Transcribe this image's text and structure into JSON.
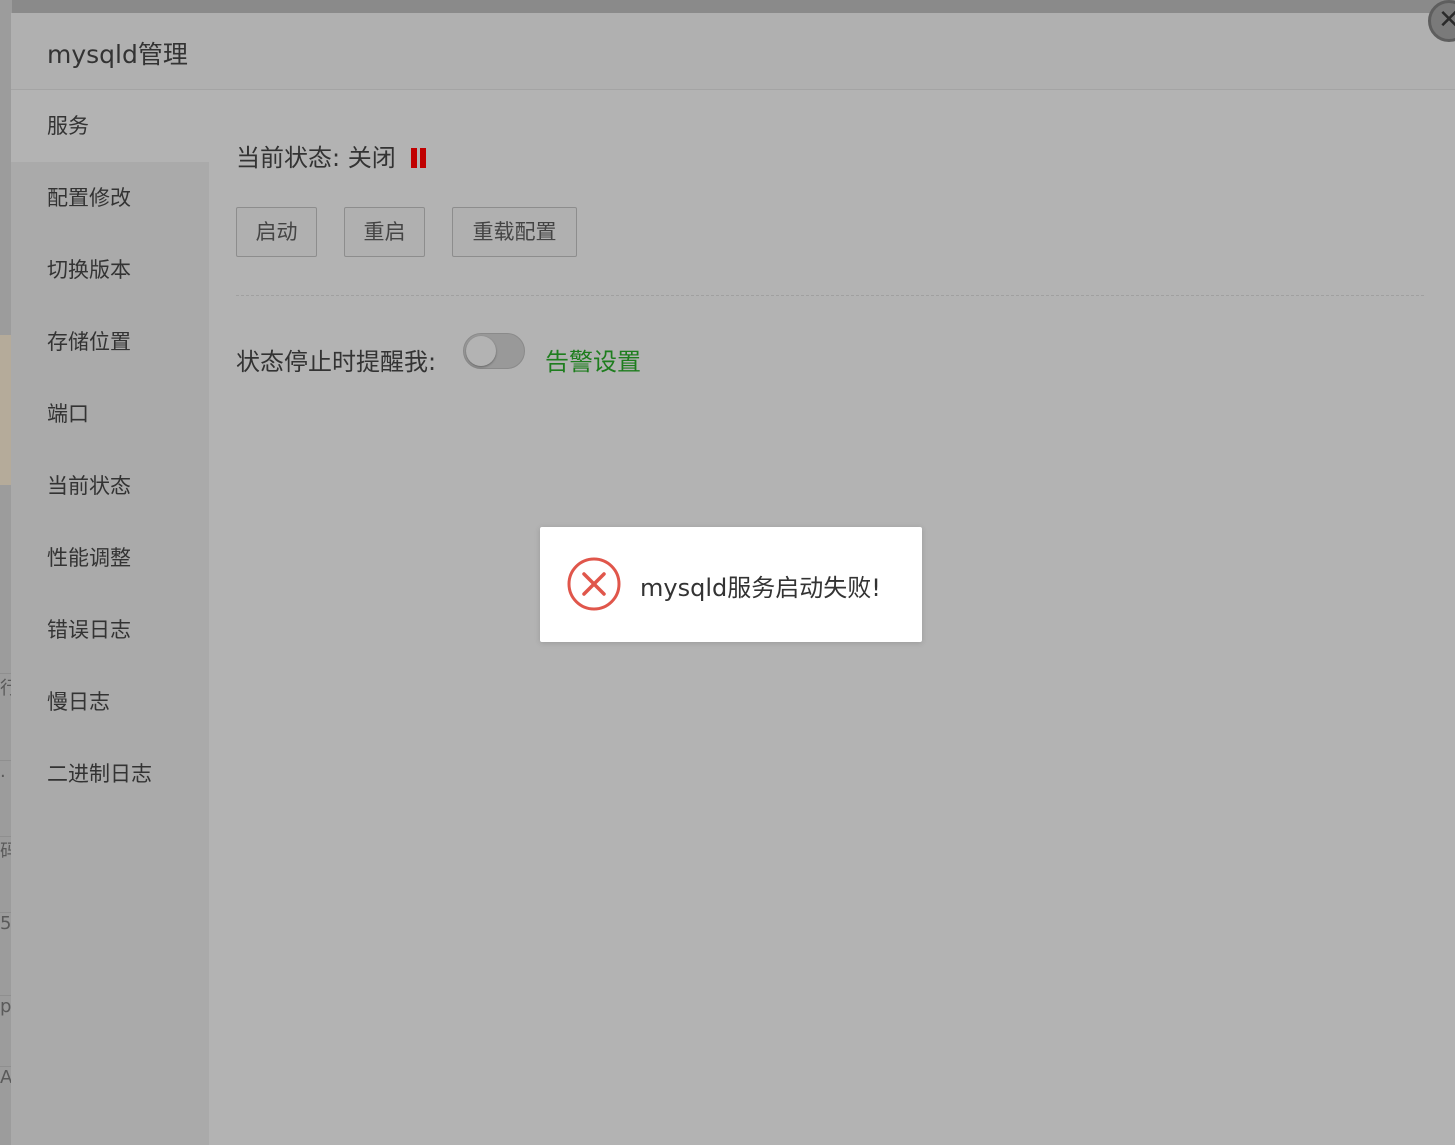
{
  "modal": {
    "title": "mysqld管理",
    "close_icon": "close-icon"
  },
  "sidebar": {
    "items": [
      {
        "label": "服务",
        "active": true
      },
      {
        "label": "配置修改"
      },
      {
        "label": "切换版本"
      },
      {
        "label": "存储位置"
      },
      {
        "label": "端口"
      },
      {
        "label": "当前状态"
      },
      {
        "label": "性能调整"
      },
      {
        "label": "错误日志"
      },
      {
        "label": "慢日志"
      },
      {
        "label": "二进制日志"
      }
    ]
  },
  "service": {
    "status_label": "当前状态:",
    "status_value": "关闭",
    "status_icon": "pause-icon",
    "status_color": "#c00000",
    "buttons": {
      "start": "启动",
      "restart": "重启",
      "reload": "重载配置"
    },
    "notify_label": "状态停止时提醒我:",
    "notify_enabled": false,
    "alert_settings_link": "告警设置",
    "link_color": "#1e7d1e"
  },
  "toast": {
    "icon": "error-circle-icon",
    "message": "mysqld服务启动失败!"
  },
  "background_fragments": [
    "行",
    ".",
    "码",
    "5",
    "p",
    "A"
  ]
}
